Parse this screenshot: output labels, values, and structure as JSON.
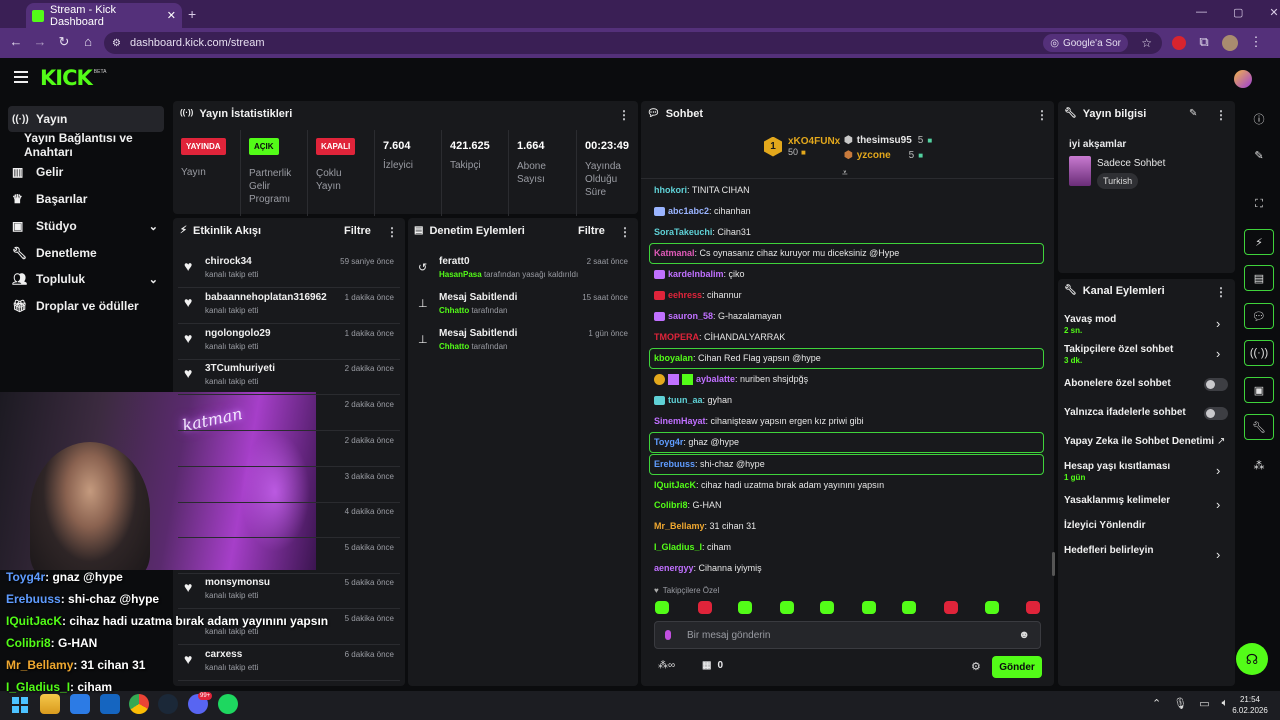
{
  "browser": {
    "tab_title": "Stream - Kick Dashboard",
    "url": "dashboard.kick.com/stream",
    "ask_google": "Google'a Sor"
  },
  "app": {
    "logo": "KICK",
    "logo_beta": "BETA"
  },
  "sidebar": {
    "items": [
      {
        "label": "Yayın",
        "icon": "broadcast-icon",
        "active": true
      },
      {
        "label": "Yayın Bağlantısı ve Anahtarı",
        "icon": ""
      },
      {
        "label": "Gelir",
        "icon": "chart-icon"
      },
      {
        "label": "Başarılar",
        "icon": "trophy-icon"
      },
      {
        "label": "Stüdyo",
        "icon": "studio-icon",
        "expandable": true
      },
      {
        "label": "Denetleme",
        "icon": "wrench-icon"
      },
      {
        "label": "Topluluk",
        "icon": "people-icon",
        "expandable": true
      },
      {
        "label": "Droplar ve ödüller",
        "icon": "gift-icon"
      }
    ]
  },
  "stats": {
    "title": "Yayın İstatistikleri",
    "badges": [
      {
        "label": "YAYINDA",
        "caption": "Yayın",
        "color": "#e0243a"
      },
      {
        "label": "AÇIK",
        "caption": "Partnerlik Gelir Programı",
        "color": "#53fc18"
      },
      {
        "label": "KAPALI",
        "caption": "Çoklu Yayın",
        "color": "#e0243a"
      }
    ],
    "metrics": [
      {
        "value": "7.604",
        "label": "İzleyici"
      },
      {
        "value": "421.625",
        "label": "Takipçi"
      },
      {
        "value": "1.664",
        "label": "Abone Sayısı"
      },
      {
        "value": "00:23:49",
        "label": "Yayında Olduğu Süre"
      }
    ]
  },
  "activity": {
    "title": "Etkinlik Akışı",
    "filter": "Filtre",
    "items": [
      {
        "name": "chirock34",
        "sub": "kanalı takip etti",
        "time": "59 saniye önce"
      },
      {
        "name": "babaannehoplatan316962",
        "sub": "kanalı takip etti",
        "time": "1 dakika önce"
      },
      {
        "name": "ngolongolo29",
        "sub": "kanalı takip etti",
        "time": "1 dakika önce"
      },
      {
        "name": "3TCumhuriyeti",
        "sub": "kanalı takip etti",
        "time": "2 dakika önce"
      },
      {
        "name": "",
        "sub": "",
        "time": "2 dakika önce"
      },
      {
        "name": "",
        "sub": "",
        "time": "2 dakika önce"
      },
      {
        "name": "",
        "sub": "",
        "time": "3 dakika önce"
      },
      {
        "name": "",
        "sub": "",
        "time": "4 dakika önce"
      },
      {
        "name": "",
        "sub": "",
        "time": "5 dakika önce"
      },
      {
        "name": "monsymonsu",
        "sub": "kanalı takip etti",
        "time": "5 dakika önce"
      },
      {
        "name": "",
        "sub": "kanalı takip etti",
        "time": "5 dakika önce"
      },
      {
        "name": "carxess",
        "sub": "kanalı takip etti",
        "time": "6 dakika önce"
      }
    ]
  },
  "moderation": {
    "title": "Denetim Eylemleri",
    "filter": "Filtre",
    "items": [
      {
        "name": "feratt0",
        "actor": "HasanPasa",
        "rest": "tarafından yasağı kaldırıldı",
        "time": "2 saat önce",
        "icon": "undo-icon"
      },
      {
        "name": "Mesaj Sabitlendi",
        "actor": "Chhatto",
        "rest": "tarafından",
        "time": "15 saat önce",
        "icon": "pin-icon"
      },
      {
        "name": "Mesaj Sabitlendi",
        "actor": "Chhatto",
        "rest": "tarafından",
        "time": "1 gün önce",
        "icon": "pin-icon"
      }
    ]
  },
  "chat": {
    "title": "Sohbet",
    "top_gifters": [
      {
        "name": "xKO4FUNx",
        "count": "50",
        "rank": "1"
      },
      {
        "name": "thesimsu95",
        "count": "5"
      },
      {
        "name": "yzcone",
        "count": "5"
      }
    ],
    "messages": [
      {
        "user": "hhokori",
        "text": "TINITA CIHAN",
        "color": "#5fd1d6"
      },
      {
        "user": "abc1abc2",
        "text": "cihanhan",
        "color": "#9ab4ff"
      },
      {
        "user": "SoraTakeuchi",
        "text": "Cihan31",
        "color": "#5fd1d6"
      },
      {
        "user": "Katmanal",
        "text": "Cs oynasanız cihaz kuruyor mu diceksiniz @Hype",
        "color": "#e05ab8",
        "highlight": true
      },
      {
        "user": "kardelnbalim",
        "text": "çiko",
        "color": "#c070ff"
      },
      {
        "user": "eehress",
        "text": "cihannur",
        "color": "#e0243a"
      },
      {
        "user": "sauron_58",
        "text": "G-hazalamayan",
        "color": "#c070ff"
      },
      {
        "user": "TMOPERA",
        "text": "CİHANDALYARRAK",
        "color": "#e0243a"
      },
      {
        "user": "kboyalan",
        "text": "Cihan Red Flag yapsın @hype",
        "color": "#53fc18",
        "highlight": true
      },
      {
        "user": "aybalatte",
        "text": "nuriben shsjdpğş",
        "color": "#c070ff"
      },
      {
        "user": "tuun_aa",
        "text": "gyhan",
        "color": "#5fd1d6"
      },
      {
        "user": "SinemHayat",
        "text": "cihanişteaw yapsın ergen kız priwi gibi",
        "color": "#c070ff"
      },
      {
        "user": "Toyg4r",
        "text": "ghaz @hype",
        "color": "#5f9cff",
        "highlight": true
      },
      {
        "user": "Erebuuss",
        "text": "shi-chaz @hype",
        "color": "#5f9cff",
        "highlight": true
      },
      {
        "user": "IQuitJacK",
        "text": "cihaz hadi uzatma bırak adam yayınını yapsın",
        "color": "#53fc18"
      },
      {
        "user": "Colibri8",
        "text": "G-HAN",
        "color": "#53fc18"
      },
      {
        "user": "Mr_Bellamy",
        "text": "31 cihan 31",
        "color": "#f0a830"
      },
      {
        "user": "I_Gladius_I",
        "text": "ciham",
        "color": "#53fc18"
      },
      {
        "user": "aenergyy",
        "text": "Cihanna iyiymiş",
        "color": "#c070ff"
      }
    ],
    "followers_only": "Takipçilere Özel",
    "input_placeholder": "Bir mesaj gönderin",
    "points": "0",
    "send": "Gönder"
  },
  "stream_info": {
    "title": "Yayın bilgisi",
    "stream_title": "iyi akşamlar",
    "category": "Sadece Sohbet",
    "tag": "Turkish"
  },
  "channel_actions": {
    "title": "Kanal Eylemleri",
    "items": [
      {
        "label": "Yavaş mod",
        "sub": "2 sn.",
        "control": "chevron"
      },
      {
        "label": "Takipçilere özel sohbet",
        "sub": "3 dk.",
        "control": "chevron"
      },
      {
        "label": "Abonelere özel sohbet",
        "sub": "",
        "control": "toggle"
      },
      {
        "label": "Yalnızca ifadelerle sohbet",
        "sub": "",
        "control": "toggle"
      },
      {
        "label": "Yapay Zeka ile Sohbet Denetimi",
        "sub": "",
        "control": "external"
      },
      {
        "label": "Hesap yaşı kısıtlaması",
        "sub": "1 gün",
        "control": "chevron"
      },
      {
        "label": "Yasaklanmış kelimeler",
        "sub": "",
        "control": "chevron"
      },
      {
        "label": "İzleyici Yönlendir",
        "sub": "",
        "control": "none"
      },
      {
        "label": "Hedefleri belirleyin",
        "sub": "",
        "control": "chevron"
      }
    ]
  },
  "overlay_chat": [
    {
      "user": "Toyg4r",
      "text": ": gnaz @hype",
      "color": "#5f9cff"
    },
    {
      "user": "Erebuuss",
      "text": ": shi-chaz @hype",
      "color": "#5f9cff"
    },
    {
      "user": "IQuitJacK",
      "text": ": cihaz hadi uzatma bırak adam yayınını yapsın",
      "color": "#53fc18"
    },
    {
      "user": "Colibri8",
      "text": ": G-HAN",
      "color": "#53fc18"
    },
    {
      "user": "Mr_Bellamy",
      "text": ": 31 cihan 31",
      "color": "#f0a830"
    },
    {
      "user": "I_Gladius_I",
      "text": ": ciham",
      "color": "#53fc18"
    }
  ],
  "taskbar": {
    "time": "21:54",
    "date": "6.02.2026",
    "discord_badge": "99+"
  },
  "colors": {
    "brand": "#53fc18",
    "live": "#e0243a",
    "browser": "#54307a"
  }
}
